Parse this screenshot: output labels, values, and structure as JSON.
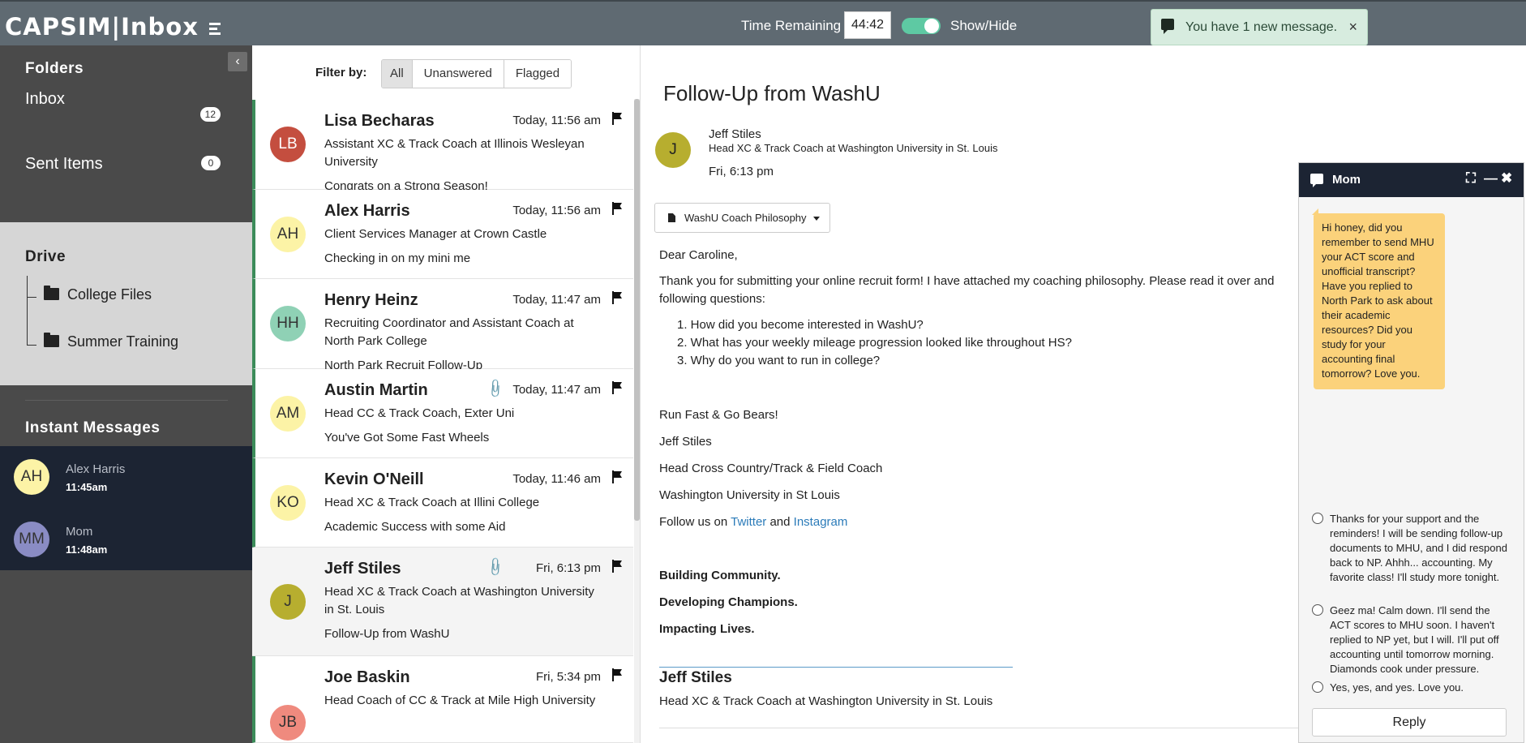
{
  "header": {
    "logo_left": "CAPSIM",
    "logo_right": "Inbox",
    "time_remaining_label": "Time Remaining",
    "timer": "44:42",
    "show_hide_label": "Show/Hide",
    "toggle_on": true,
    "notification": "You have 1 new message.",
    "notification_close": "×"
  },
  "sidebar": {
    "folders_title": "Folders",
    "folders": [
      {
        "label": "Inbox",
        "count": "12"
      },
      {
        "label": "Sent Items",
        "count": "0"
      }
    ],
    "drive_title": "Drive",
    "drive_items": [
      {
        "label": "College Files"
      },
      {
        "label": "Summer Training"
      }
    ],
    "im_title": "Instant Messages",
    "im_contacts": [
      {
        "initials": "AH",
        "name": "Alex Harris",
        "time": "11:45am",
        "color": "#fcf3a6"
      },
      {
        "initials": "MM",
        "name": "Mom",
        "time": "11:48am",
        "color": "#8a8cc4"
      }
    ]
  },
  "message_list": {
    "filter_label": "Filter by:",
    "filters": [
      "All",
      "Unanswered",
      "Flagged"
    ],
    "active_filter": "All",
    "messages": [
      {
        "initials": "LB",
        "color": "#c44e3f",
        "name": "Lisa Becharas",
        "time": "Today, 11:56 am",
        "sub1": "Assistant XC & Track Coach at Illinois Wesleyan",
        "sub2": "University",
        "preview": "Congrats on a Strong Season!",
        "attachment": false
      },
      {
        "initials": "AH",
        "color": "#fcf3a6",
        "name": "Alex Harris",
        "time": "Today, 11:56 am",
        "sub1": "Client Services Manager at Crown Castle",
        "sub2": "",
        "preview": "Checking in on my mini me",
        "attachment": false
      },
      {
        "initials": "HH",
        "color": "#8fd1b5",
        "name": "Henry Heinz",
        "time": "Today, 11:47 am",
        "sub1": "Recruiting Coordinator and Assistant Coach at",
        "sub2": "North Park College",
        "preview": "North Park Recruit Follow-Up",
        "attachment": false
      },
      {
        "initials": "AM",
        "color": "#fcf3a6",
        "name": "Austin Martin",
        "time": "Today, 11:47 am",
        "sub1": "Head CC & Track Coach, Exter Uni",
        "sub2": "",
        "preview": "You've Got Some Fast Wheels",
        "attachment": true
      },
      {
        "initials": "KO",
        "color": "#fcf3a6",
        "name": "Kevin O'Neill",
        "time": "Today, 11:46 am",
        "sub1": "Head XC & Track Coach at Illini College",
        "sub2": "",
        "preview": "Academic Success with some Aid",
        "attachment": false
      },
      {
        "initials": "J",
        "color": "#b7ae2f",
        "name": "Jeff Stiles",
        "time": "Fri, 6:13 pm",
        "sub1": "Head XC & Track Coach at Washington University",
        "sub2": "in St. Louis",
        "preview": "Follow-Up from WashU",
        "attachment": true
      },
      {
        "initials": "JB",
        "color": "#ef8a7e",
        "name": "Joe Baskin",
        "time": "Fri, 5:34 pm",
        "sub1": "Head Coach of CC & Track at Mile High University",
        "sub2": "",
        "preview": "",
        "attachment": false
      }
    ]
  },
  "reader": {
    "subject": "Follow-Up from WashU",
    "sender_initial": "J",
    "sender_name": "Jeff Stiles",
    "sender_title": "Head XC & Track Coach at Washington University in St. Louis",
    "date": "Fri, 6:13 pm",
    "attachment": "WashU Coach Philosophy",
    "greeting": "Dear Caroline,",
    "intro": "Thank you for submitting your online recruit form!  I have attached my coaching philosophy. Please read it over and",
    "intro2": "following questions:",
    "questions": [
      "1. How did you become interested in WashU?",
      "2. What has your weekly mileage progression looked like throughout HS?",
      "3. Why do you want to run in college?"
    ],
    "signoff": "Run Fast & Go Bears!",
    "sig_name": "Jeff Stiles",
    "sig_role": "Head Cross Country/Track & Field Coach",
    "sig_school": "Washington University in St Louis",
    "follow_prefix": "Follow us on ",
    "follow_twitter": "Twitter",
    "follow_and": " and ",
    "follow_instagram": "Instagram",
    "motto": [
      "Building Community.",
      "Developing Champions.",
      "Impacting Lives."
    ],
    "sig_block_name": "Jeff Stiles",
    "sig_block_title": "Head XC & Track Coach at Washington University in St. Louis"
  },
  "chat": {
    "title": "Mom",
    "message": "Hi honey, did you remember to send MHU your ACT score and unofficial transcript? Have you replied to North Park to ask about their academic resources? Did you study for your accounting final tomorrow? Love you.",
    "options": [
      "Thanks for your support and the reminders! I will be sending follow-up documents to MHU, and I did respond back to NP. Ahhh... accounting. My favorite class! I'll study more tonight.",
      "Geez ma! Calm down. I'll send the ACT scores to MHU soon. I haven't replied to NP yet, but I will. I'll put off accounting until tomorrow morning. Diamonds cook under pressure.",
      "Yes, yes, and yes. Love you."
    ],
    "reply_label": "Reply"
  }
}
